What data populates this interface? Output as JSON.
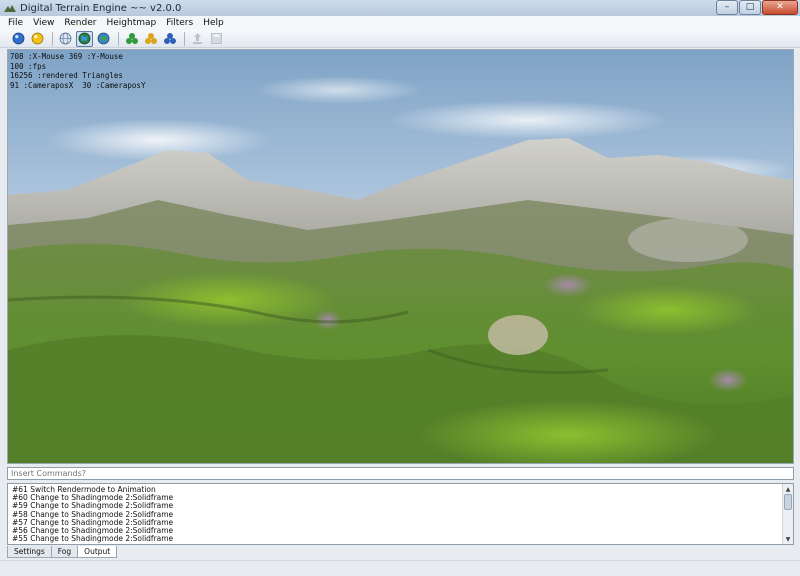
{
  "window": {
    "title": "Digital Terrain Engine ~~ v2.0.0",
    "minimize_glyph": "–",
    "maximize_glyph": "□",
    "close_glyph": "✕"
  },
  "menu": {
    "items": [
      "File",
      "View",
      "Render",
      "Heightmap",
      "Filters",
      "Help"
    ]
  },
  "toolbar": {
    "buttons": [
      {
        "icon": "blue-orb-icon",
        "color": "#2f6fd1"
      },
      {
        "icon": "yellow-orb-icon",
        "color": "#f2c21b"
      },
      {
        "icon": "wireframe-globe-icon",
        "color": "#6b8fb8"
      },
      {
        "icon": "solid-globe-icon",
        "color": "#2a7f4a",
        "active": true
      },
      {
        "icon": "textured-globe-icon",
        "color": "#3b86c9"
      },
      {
        "icon": "green-spheres-icon",
        "color": "#2e9a3a"
      },
      {
        "icon": "yellow-spheres-icon",
        "color": "#d9a418"
      },
      {
        "icon": "blue-spheres-icon",
        "color": "#2f5fb8"
      },
      {
        "icon": "export-icon",
        "color": "#b9c2cc"
      },
      {
        "icon": "save-icon",
        "color": "#b9c2cc"
      }
    ]
  },
  "hud": {
    "lines": [
      "708 :X-Mouse 369 :Y-Mouse",
      "100 :fps",
      "16256 :rendered Triangles",
      "91 :CameraposX  30 :CameraposY"
    ]
  },
  "command": {
    "placeholder": "Insert Commands?"
  },
  "log": {
    "lines": [
      "#61 Switch Rendermode to Animation",
      "#60 Change to Shadingmode 2:Solidframe",
      "#59 Change to Shadingmode 2:Solidframe",
      "#58 Change to Shadingmode 2:Solidframe",
      "#57 Change to Shadingmode 2:Solidframe",
      "#56 Change to Shadingmode 2:Solidframe",
      "#55 Change to Shadingmode 2:Solidframe"
    ]
  },
  "tabs": [
    {
      "label": "Settings",
      "active": false
    },
    {
      "label": "Fog",
      "active": false
    },
    {
      "label": "Output",
      "active": true
    }
  ],
  "colors": {
    "sky": "#a9c2db",
    "grass": "#5f8f2e",
    "rock": "#b9b9b4"
  }
}
